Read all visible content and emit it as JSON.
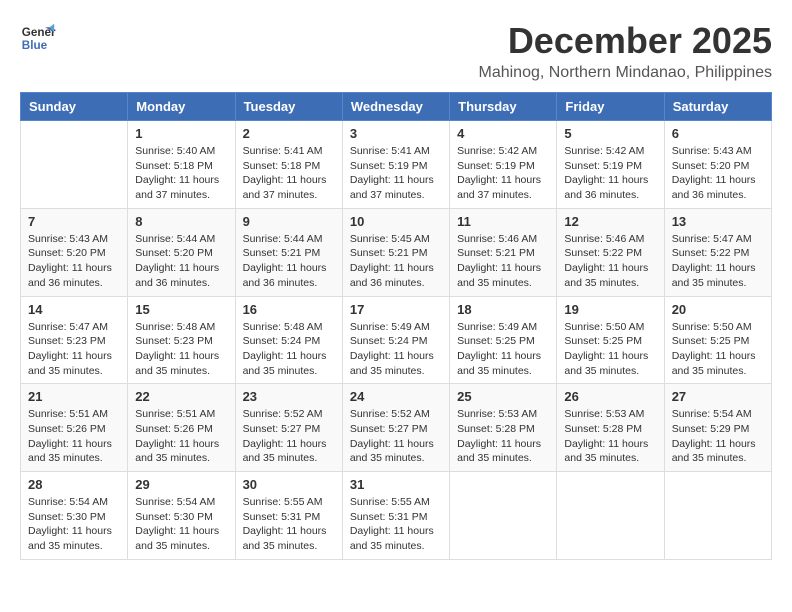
{
  "header": {
    "logo_line1": "General",
    "logo_line2": "Blue",
    "month": "December 2025",
    "location": "Mahinog, Northern Mindanao, Philippines"
  },
  "weekdays": [
    "Sunday",
    "Monday",
    "Tuesday",
    "Wednesday",
    "Thursday",
    "Friday",
    "Saturday"
  ],
  "weeks": [
    [
      {
        "day": "",
        "info": ""
      },
      {
        "day": "1",
        "info": "Sunrise: 5:40 AM\nSunset: 5:18 PM\nDaylight: 11 hours and 37 minutes."
      },
      {
        "day": "2",
        "info": "Sunrise: 5:41 AM\nSunset: 5:18 PM\nDaylight: 11 hours and 37 minutes."
      },
      {
        "day": "3",
        "info": "Sunrise: 5:41 AM\nSunset: 5:19 PM\nDaylight: 11 hours and 37 minutes."
      },
      {
        "day": "4",
        "info": "Sunrise: 5:42 AM\nSunset: 5:19 PM\nDaylight: 11 hours and 37 minutes."
      },
      {
        "day": "5",
        "info": "Sunrise: 5:42 AM\nSunset: 5:19 PM\nDaylight: 11 hours and 36 minutes."
      },
      {
        "day": "6",
        "info": "Sunrise: 5:43 AM\nSunset: 5:20 PM\nDaylight: 11 hours and 36 minutes."
      }
    ],
    [
      {
        "day": "7",
        "info": "Sunrise: 5:43 AM\nSunset: 5:20 PM\nDaylight: 11 hours and 36 minutes."
      },
      {
        "day": "8",
        "info": "Sunrise: 5:44 AM\nSunset: 5:20 PM\nDaylight: 11 hours and 36 minutes."
      },
      {
        "day": "9",
        "info": "Sunrise: 5:44 AM\nSunset: 5:21 PM\nDaylight: 11 hours and 36 minutes."
      },
      {
        "day": "10",
        "info": "Sunrise: 5:45 AM\nSunset: 5:21 PM\nDaylight: 11 hours and 36 minutes."
      },
      {
        "day": "11",
        "info": "Sunrise: 5:46 AM\nSunset: 5:21 PM\nDaylight: 11 hours and 35 minutes."
      },
      {
        "day": "12",
        "info": "Sunrise: 5:46 AM\nSunset: 5:22 PM\nDaylight: 11 hours and 35 minutes."
      },
      {
        "day": "13",
        "info": "Sunrise: 5:47 AM\nSunset: 5:22 PM\nDaylight: 11 hours and 35 minutes."
      }
    ],
    [
      {
        "day": "14",
        "info": "Sunrise: 5:47 AM\nSunset: 5:23 PM\nDaylight: 11 hours and 35 minutes."
      },
      {
        "day": "15",
        "info": "Sunrise: 5:48 AM\nSunset: 5:23 PM\nDaylight: 11 hours and 35 minutes."
      },
      {
        "day": "16",
        "info": "Sunrise: 5:48 AM\nSunset: 5:24 PM\nDaylight: 11 hours and 35 minutes."
      },
      {
        "day": "17",
        "info": "Sunrise: 5:49 AM\nSunset: 5:24 PM\nDaylight: 11 hours and 35 minutes."
      },
      {
        "day": "18",
        "info": "Sunrise: 5:49 AM\nSunset: 5:25 PM\nDaylight: 11 hours and 35 minutes."
      },
      {
        "day": "19",
        "info": "Sunrise: 5:50 AM\nSunset: 5:25 PM\nDaylight: 11 hours and 35 minutes."
      },
      {
        "day": "20",
        "info": "Sunrise: 5:50 AM\nSunset: 5:25 PM\nDaylight: 11 hours and 35 minutes."
      }
    ],
    [
      {
        "day": "21",
        "info": "Sunrise: 5:51 AM\nSunset: 5:26 PM\nDaylight: 11 hours and 35 minutes."
      },
      {
        "day": "22",
        "info": "Sunrise: 5:51 AM\nSunset: 5:26 PM\nDaylight: 11 hours and 35 minutes."
      },
      {
        "day": "23",
        "info": "Sunrise: 5:52 AM\nSunset: 5:27 PM\nDaylight: 11 hours and 35 minutes."
      },
      {
        "day": "24",
        "info": "Sunrise: 5:52 AM\nSunset: 5:27 PM\nDaylight: 11 hours and 35 minutes."
      },
      {
        "day": "25",
        "info": "Sunrise: 5:53 AM\nSunset: 5:28 PM\nDaylight: 11 hours and 35 minutes."
      },
      {
        "day": "26",
        "info": "Sunrise: 5:53 AM\nSunset: 5:28 PM\nDaylight: 11 hours and 35 minutes."
      },
      {
        "day": "27",
        "info": "Sunrise: 5:54 AM\nSunset: 5:29 PM\nDaylight: 11 hours and 35 minutes."
      }
    ],
    [
      {
        "day": "28",
        "info": "Sunrise: 5:54 AM\nSunset: 5:30 PM\nDaylight: 11 hours and 35 minutes."
      },
      {
        "day": "29",
        "info": "Sunrise: 5:54 AM\nSunset: 5:30 PM\nDaylight: 11 hours and 35 minutes."
      },
      {
        "day": "30",
        "info": "Sunrise: 5:55 AM\nSunset: 5:31 PM\nDaylight: 11 hours and 35 minutes."
      },
      {
        "day": "31",
        "info": "Sunrise: 5:55 AM\nSunset: 5:31 PM\nDaylight: 11 hours and 35 minutes."
      },
      {
        "day": "",
        "info": ""
      },
      {
        "day": "",
        "info": ""
      },
      {
        "day": "",
        "info": ""
      }
    ]
  ]
}
